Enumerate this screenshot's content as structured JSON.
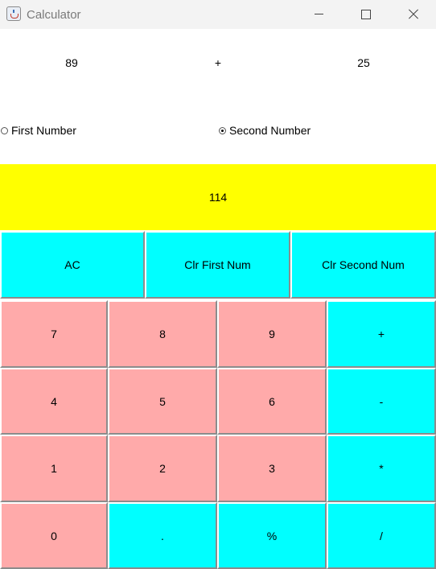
{
  "window": {
    "title": "Calculator"
  },
  "display": {
    "first_number": "89",
    "operator": "+",
    "second_number": "25",
    "result": "114"
  },
  "radios": {
    "first_label": "First Number",
    "second_label": "Second Number",
    "selected": "Second Number"
  },
  "clear_buttons": {
    "ac": "AC",
    "clr_first": "Clr First Num",
    "clr_second": "Clr Second Num"
  },
  "keypad": {
    "k7": "7",
    "k8": "8",
    "k9": "9",
    "plus": "+",
    "k4": "4",
    "k5": "5",
    "k6": "6",
    "minus": "-",
    "k1": "1",
    "k2": "2",
    "k3": "3",
    "multiply": "*",
    "k0": "0",
    "dot": ".",
    "percent": "%",
    "divide": "/"
  },
  "colors": {
    "result_bg": "#ffff00",
    "operator_bg": "#00ffff",
    "digit_bg": "#ffaaaa"
  },
  "icons": [
    "java-app-icon",
    "minimize-icon",
    "maximize-icon",
    "close-icon"
  ]
}
